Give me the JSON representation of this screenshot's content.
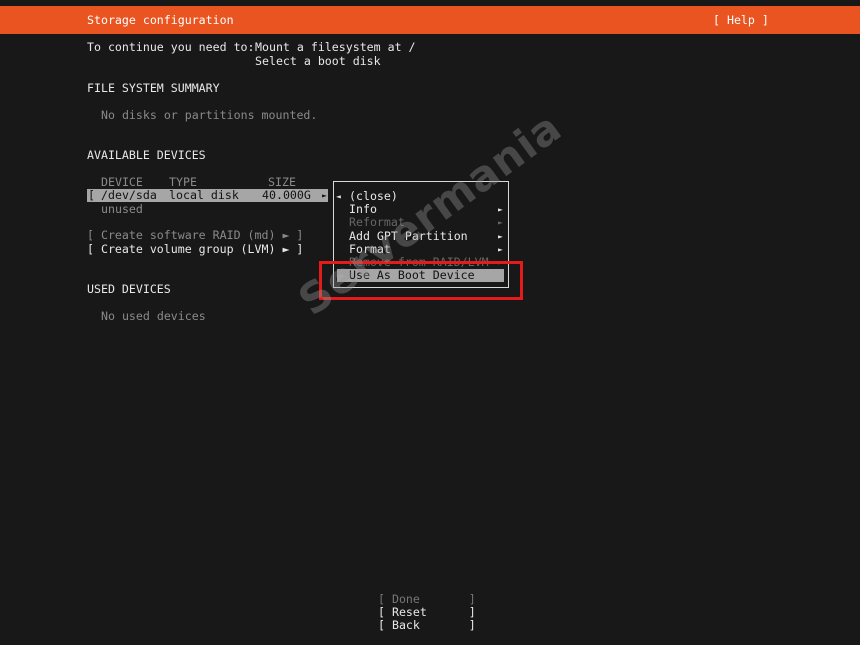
{
  "header": {
    "title": "Storage configuration",
    "help": "[ Help ]"
  },
  "intro": {
    "label": "To continue you need to:",
    "line1": "Mount a filesystem at /",
    "line2": "Select a boot disk"
  },
  "fs_summary": {
    "heading": "FILE SYSTEM SUMMARY",
    "empty": "No disks or partitions mounted."
  },
  "available": {
    "heading": "AVAILABLE DEVICES",
    "columns": [
      "DEVICE",
      "TYPE",
      "SIZE"
    ],
    "device_row": {
      "bracket_open": "[",
      "device": "/dev/sda",
      "type": "local disk",
      "size": "40.000G",
      "arrow": "►"
    },
    "unused": "unused",
    "create_raid": "[ Create software RAID (md) ► ]",
    "create_lvm": "[ Create volume group (LVM) ► ]"
  },
  "used": {
    "heading": "USED DEVICES",
    "empty": "No used devices"
  },
  "menu": {
    "close_arrow": "◄",
    "close": "(close)",
    "items": [
      {
        "label": "Info",
        "arrow": "►"
      },
      {
        "label": "Reformat",
        "arrow": "►"
      },
      {
        "label": "Add GPT Partition",
        "arrow": "►"
      },
      {
        "label": "Format",
        "arrow": "►"
      },
      {
        "label": "Remove from RAID/LVM",
        "arrow": "►"
      },
      {
        "label": "Use As Boot Device"
      }
    ]
  },
  "buttons": {
    "done": "[ Done       ]",
    "reset": "[ Reset      ]",
    "back": "[ Back       ]"
  },
  "watermark": "Servermania",
  "colors": {
    "accent": "#e95420",
    "highlight": "#a6a6a6",
    "annotation": "#e41b1b",
    "background": "#181818"
  }
}
